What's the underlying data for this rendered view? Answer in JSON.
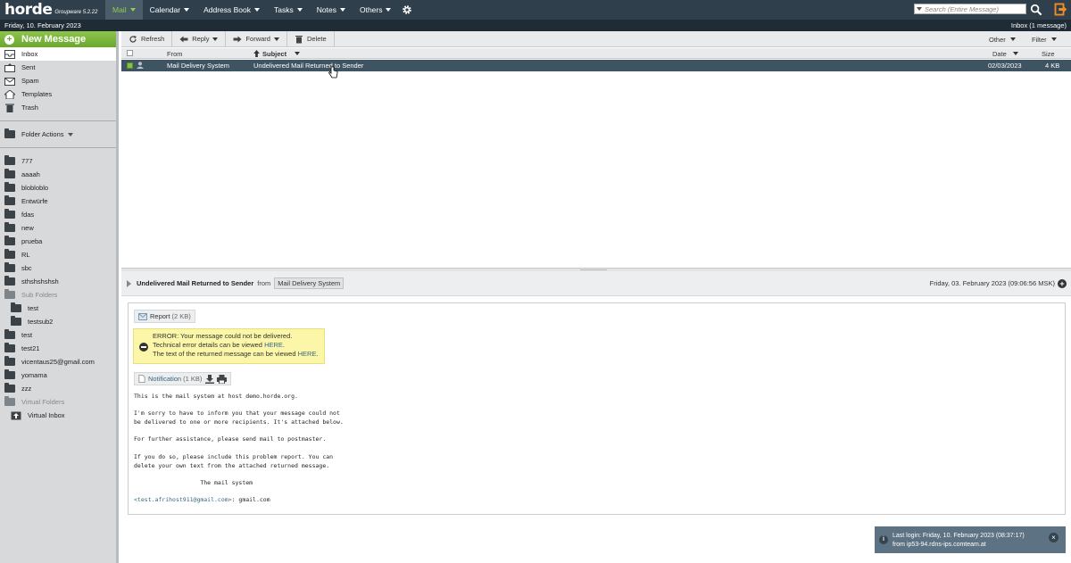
{
  "app": {
    "brand": "horde",
    "version": "Groupware 5.2.22",
    "date_line": "Friday, 10. February 2023",
    "mailbox_status": "Inbox (1 message)"
  },
  "topmenu": [
    {
      "label": "Mail",
      "active": true
    },
    {
      "label": "Calendar"
    },
    {
      "label": "Address Book"
    },
    {
      "label": "Tasks"
    },
    {
      "label": "Notes"
    },
    {
      "label": "Others"
    }
  ],
  "search": {
    "placeholder": "Search (Entire Message)"
  },
  "sidebar": {
    "new_message": "New Message",
    "mailboxes": [
      {
        "label": "Inbox",
        "icon": "inbox-icon",
        "selected": true
      },
      {
        "label": "Sent",
        "icon": "sent-icon"
      },
      {
        "label": "Spam",
        "icon": "spam-icon"
      },
      {
        "label": "Templates",
        "icon": "templates-icon"
      },
      {
        "label": "Trash",
        "icon": "trash-icon"
      }
    ],
    "folder_actions": "Folder Actions",
    "folders": [
      {
        "label": "777"
      },
      {
        "label": "aaaah"
      },
      {
        "label": "blobloblo"
      },
      {
        "label": "Entwürfe"
      },
      {
        "label": "fdas"
      },
      {
        "label": "new"
      },
      {
        "label": "prueba"
      },
      {
        "label": "RL"
      },
      {
        "label": "sbc"
      },
      {
        "label": "sthshshshsh"
      },
      {
        "label": "Sub Folders",
        "dim": true
      },
      {
        "label": "test",
        "indent": 1
      },
      {
        "label": "testsub2",
        "indent": 1
      },
      {
        "label": "test"
      },
      {
        "label": "test21"
      },
      {
        "label": "vicentaus25@gmail.com"
      },
      {
        "label": "yomama"
      },
      {
        "label": "zzz"
      },
      {
        "label": "Virtual Folders",
        "dim": true
      },
      {
        "label": "Virtual Inbox",
        "indent": 1,
        "virtual": true
      }
    ]
  },
  "toolbar": {
    "refresh": "Refresh",
    "reply": "Reply",
    "forward": "Forward",
    "delete": "Delete",
    "other": "Other",
    "filter": "Filter"
  },
  "list": {
    "headers": {
      "from": "From",
      "subject": "Subject",
      "date": "Date",
      "size": "Size"
    },
    "rows": [
      {
        "from": "Mail Delivery System",
        "subject": "Undelivered Mail Returned to Sender",
        "date": "02/03/2023",
        "size": "4 KB"
      }
    ]
  },
  "preview": {
    "subject": "Undelivered Mail Returned to Sender",
    "from_word": "from",
    "sender": "Mail Delivery System",
    "date": "Friday, 03. February 2023 (09:06:56 MSK)",
    "report_label": "Report",
    "report_size": "(2 KB)",
    "error_line1": "ERROR: Your message could not be delivered.",
    "error_line2_prefix": "Technical error details can be viewed ",
    "error_line3_prefix": "The text of the returned message can be viewed ",
    "here": "HERE",
    "notification_label": "Notification",
    "notification_size": "(1 KB)",
    "body_lines": [
      "This is the mail system at host demo.horde.org.",
      "",
      "I'm sorry to have to inform you that your message could not",
      "be delivered to one or more recipients. It's attached below.",
      "",
      "For further assistance, please send mail to postmaster.",
      "",
      "If you do so, please include this problem report. You can",
      "delete your own text from the attached returned message.",
      "",
      "                   The mail system",
      ""
    ],
    "bounce_addr": "<test.afrihost911@gmail.com>",
    "bounce_rest": ": gmail.com"
  },
  "notification": {
    "line1": "Last login: Friday, 10. February 2023 (08:37:17)",
    "line2": "from ip53-94.rdns-ips.comteam.at"
  },
  "colors": {
    "topbar": "#2f3f4c",
    "accent_green": "#8ad14a",
    "selected_row": "#3f5463",
    "error_bg": "#fbf6a8"
  }
}
